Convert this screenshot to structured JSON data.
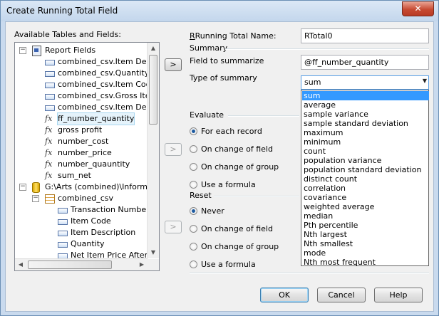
{
  "window": {
    "title": "Create Running Total Field",
    "close_glyph": "✕"
  },
  "left_panel": {
    "label": "Available Tables and Fields:",
    "tree": [
      {
        "text": "Report Fields",
        "icon": "report-icon",
        "level": 0,
        "expander": "−"
      },
      {
        "text": "combined_csv.Item Descr",
        "icon": "field-icon",
        "level": 1
      },
      {
        "text": "combined_csv.Quantity",
        "icon": "field-icon",
        "level": 1
      },
      {
        "text": "combined_csv.Item Code",
        "icon": "field-icon",
        "level": 1
      },
      {
        "text": "combined_csv.Gross Item",
        "icon": "field-icon",
        "level": 1
      },
      {
        "text": "combined_csv.Item Descr",
        "icon": "field-icon",
        "level": 1
      },
      {
        "text": "ff_number_quantity",
        "icon": "formula-icon",
        "level": 1,
        "selected": true
      },
      {
        "text": "gross profit",
        "icon": "formula-icon",
        "level": 1
      },
      {
        "text": "number_cost",
        "icon": "formula-icon",
        "level": 1
      },
      {
        "text": "number_price",
        "icon": "formula-icon",
        "level": 1
      },
      {
        "text": "number_quauntity",
        "icon": "formula-icon",
        "level": 1
      },
      {
        "text": "sum_net",
        "icon": "formula-icon",
        "level": 1
      },
      {
        "text": "G:\\Arts (combined)\\Informatio",
        "icon": "database-icon",
        "level": 0,
        "expander": "−"
      },
      {
        "text": "combined_csv",
        "icon": "table-icon",
        "level": 1,
        "expander": "−"
      },
      {
        "text": "Transaction Number",
        "icon": "field-icon",
        "level": 2
      },
      {
        "text": "Item Code",
        "icon": "field-icon",
        "level": 2
      },
      {
        "text": "Item Description",
        "icon": "field-icon",
        "level": 2
      },
      {
        "text": "Quantity",
        "icon": "field-icon",
        "level": 2
      },
      {
        "text": "Net Item Price After S",
        "icon": "field-icon",
        "level": 2
      }
    ]
  },
  "buttons": {
    "arrow_summarize": ">",
    "arrow_evaluate": ">",
    "arrow_reset": ">",
    "ok": "OK",
    "cancel": "Cancel",
    "help": "Help"
  },
  "running_total_name": {
    "label": "Running Total Name:",
    "value": "RTotal0"
  },
  "summary": {
    "heading": "Summary",
    "field_label": "Field to summarize",
    "field_value": "@ff_number_quantity",
    "type_label": "Type of summary",
    "type_value": "sum",
    "options": [
      "sum",
      "average",
      "sample variance",
      "sample standard deviation",
      "maximum",
      "minimum",
      "count",
      "population variance",
      "population standard deviation",
      "distinct count",
      "correlation",
      "covariance",
      "weighted average",
      "median",
      "Pth percentile",
      "Nth largest",
      "Nth smallest",
      "mode",
      "Nth most frequent"
    ]
  },
  "evaluate": {
    "heading": "Evaluate",
    "options": [
      {
        "label": "For each record",
        "checked": true
      },
      {
        "label": "On change of field",
        "checked": false
      },
      {
        "label": "On change of group",
        "checked": false
      },
      {
        "label": "Use a formula",
        "checked": false
      }
    ]
  },
  "reset": {
    "heading": "Reset",
    "options": [
      {
        "label": "Never",
        "checked": true
      },
      {
        "label": "On change of field",
        "checked": false
      },
      {
        "label": "On change of group",
        "checked": false
      },
      {
        "label": "Use a formula",
        "checked": false
      }
    ]
  },
  "colors": {
    "accent": "#3399ff",
    "title_bar": "#c9daee",
    "close": "#c74a32"
  }
}
